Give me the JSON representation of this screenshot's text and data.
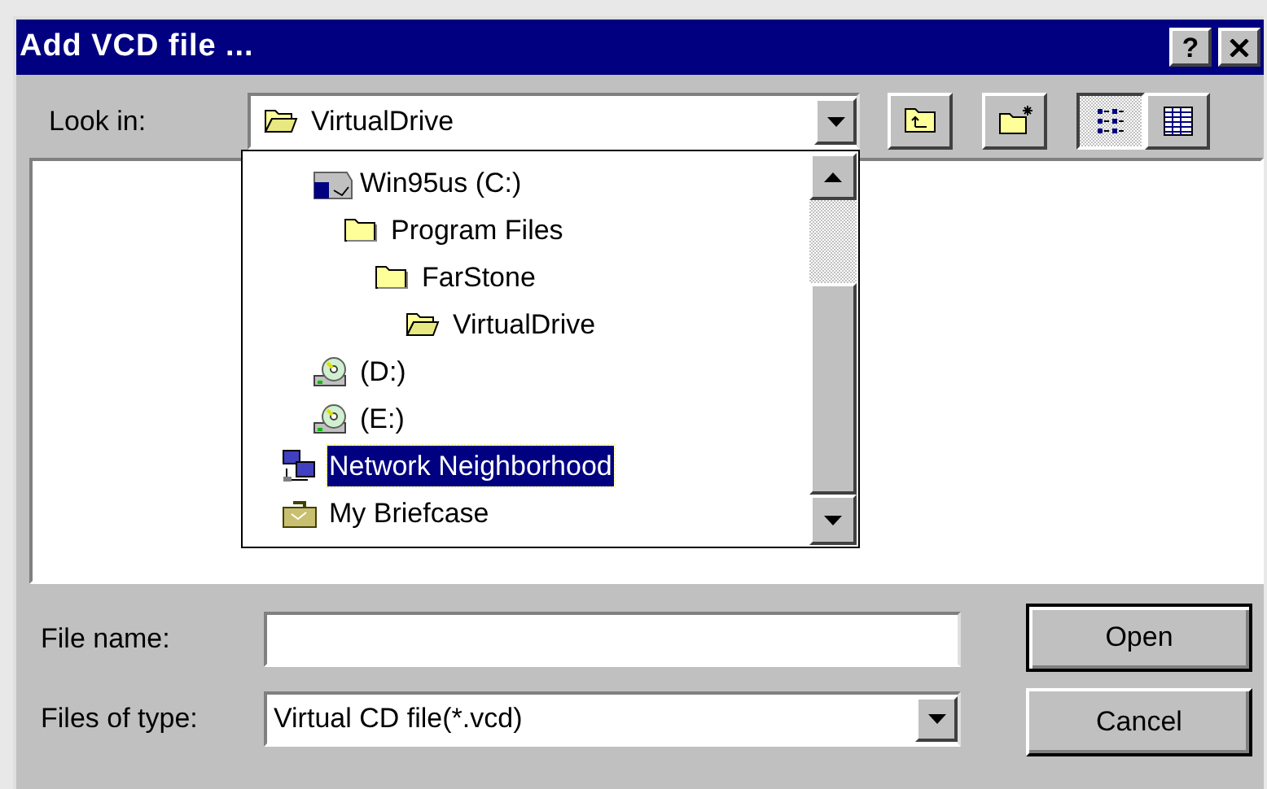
{
  "window": {
    "title": "Add VCD file ...",
    "help_button": {
      "label": "?"
    }
  },
  "look_in": {
    "label": "Look in:",
    "value": "VirtualDrive",
    "kind": "open-folder"
  },
  "toolbar": [
    {
      "kind": "up-folder",
      "selected": false
    },
    {
      "kind": "new-folder",
      "selected": false
    },
    {
      "kind": "list-view",
      "selected": true
    },
    {
      "kind": "details-view",
      "selected": false
    }
  ],
  "dropdown": {
    "items": [
      {
        "children": [
          {
            "label": "Win95us (C:)",
            "kind": "hard-drive",
            "selected": false,
            "children": [
              {
                "label": "Program Files",
                "kind": "folder",
                "selected": false,
                "children": [
                  {
                    "label": "FarStone",
                    "kind": "folder",
                    "selected": false,
                    "children": [
                      {
                        "label": "VirtualDrive",
                        "kind": "open-folder",
                        "selected": false
                      }
                    ]
                  }
                ]
              }
            ]
          },
          {
            "label": "(D:)",
            "kind": "cd-drive",
            "selected": false
          },
          {
            "label": "(E:)",
            "kind": "cd-drive",
            "selected": false
          }
        ]
      },
      {
        "label": "Network Neighborhood",
        "kind": "network",
        "selected": true
      },
      {
        "label": "My Briefcase",
        "kind": "briefcase",
        "selected": false
      }
    ]
  },
  "file_name": {
    "label": "File name:"
  },
  "file_type": {
    "label": "Files of type:",
    "value": "Virtual CD file(*.vcd)"
  },
  "buttons": [
    {
      "label": "Open",
      "default": true
    },
    {
      "label": "Cancel",
      "default": false
    }
  ]
}
